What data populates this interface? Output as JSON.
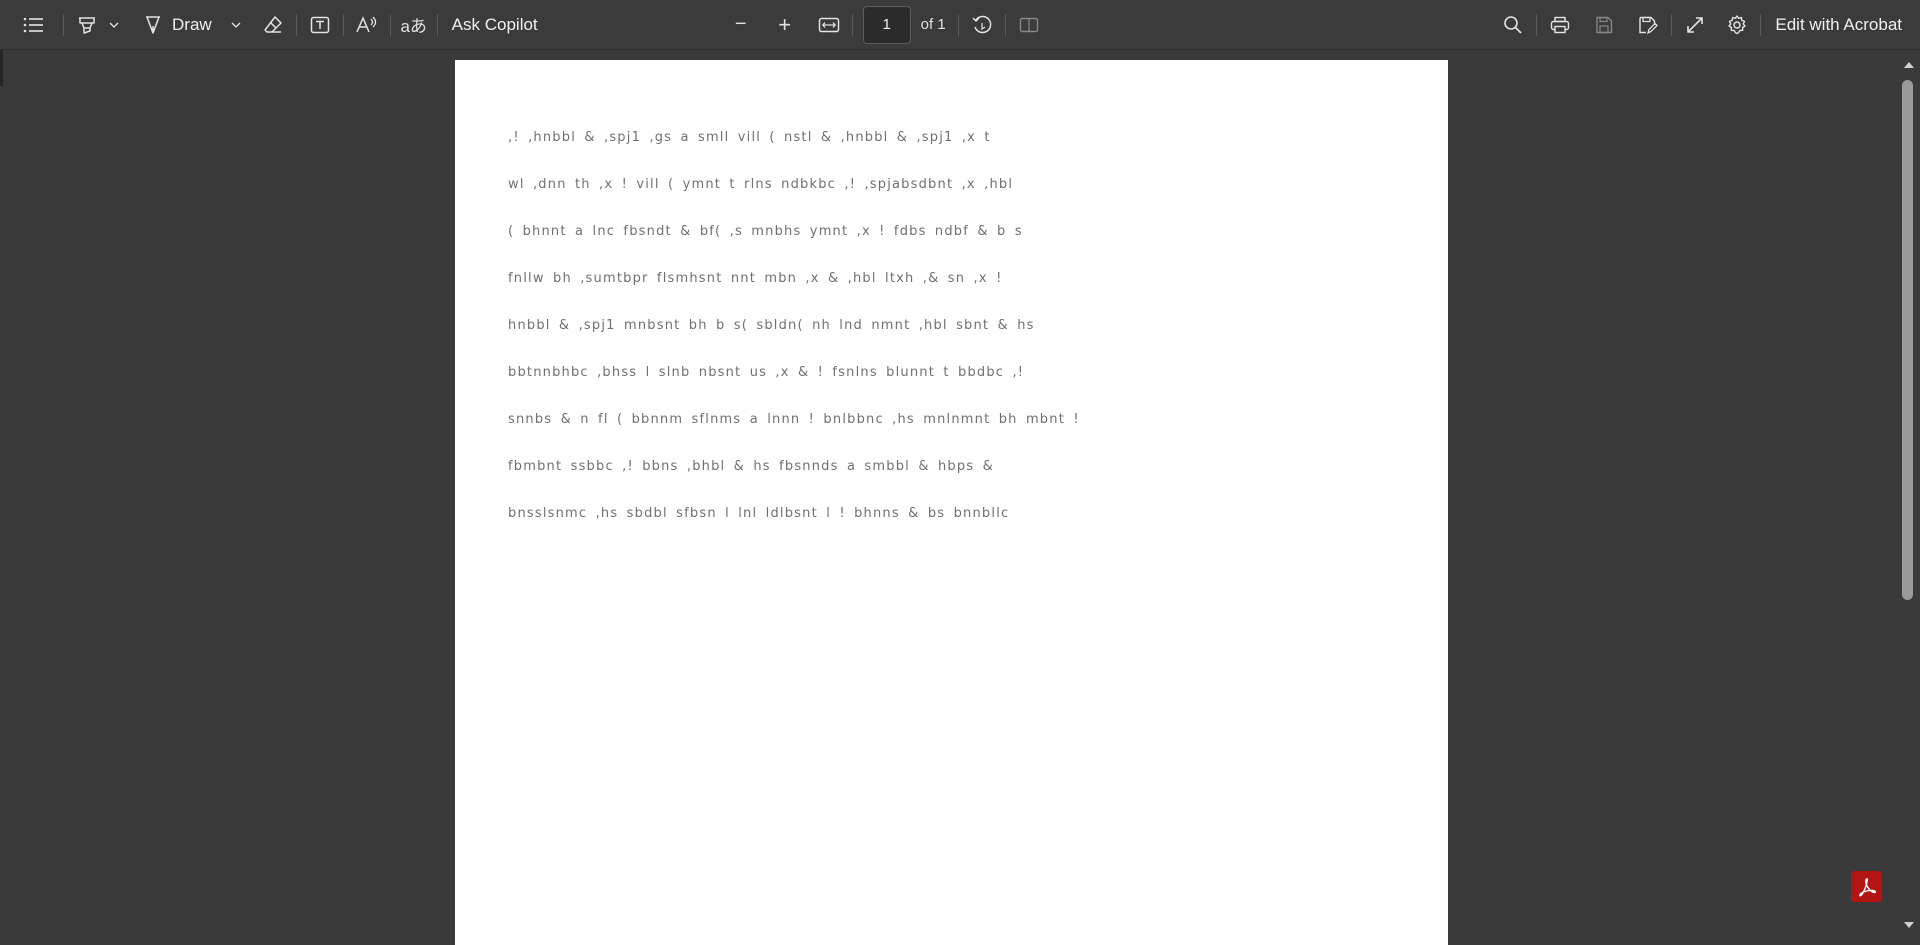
{
  "toolbar": {
    "contents_icon": "list-icon",
    "highlight_icon": "highlighter-icon",
    "draw_label": "Draw",
    "erase_icon": "eraser-icon",
    "text_icon": "text-box-icon",
    "read_aloud_icon": "read-aloud-icon",
    "translate_glyph": "aあ",
    "ask_copilot_label": "Ask Copilot",
    "zoom_out_glyph": "−",
    "zoom_in_glyph": "+",
    "page_number": "1",
    "page_total": "of 1",
    "edit_acrobat_label": "Edit with Acrobat"
  },
  "document": {
    "braille_lines": [
      ",! ,hnbbl & ,spj1 ,gs a smll vill ( nstl & ,hnbbl & ,spj1 ,x t",
      "wl ,dnn th ,x ! vill ( ymnt t rlns ndbkbc ,! ,spjabsdbnt ,x ,hbl",
      "( bhnnt a lnc fbsndt & bf( ,s mnbhs ymnt ,x ! fdbs ndbf & b s",
      "fnllw bh ,sumtbpr flsmhsnt nnt mbn ,x & ,hbl ltxh ,& sn ,x !",
      "hnbbl & ,spj1 mnbsnt bh b s( sbldn( nh lnd nmnt ,hbl sbnt & hs",
      "bbtnnbhbc ,bhss l slnb nbsnt us ,x & ! fsnlns blunnt t bbdbc ,!",
      "snnbs & n fl ( bbnnm sflnms a lnnn ! bnlbbnc ,hs mnlnmnt bh mbnt !",
      "fbmbnt ssbbc ,! bbns ,bhbl & hs fbsnnds a smbbl & hbps &",
      "bnsslsnmc ,hs sbdbl sfbsn l lnl ldlbsnt l ! bhnns & bs bnnbllc"
    ]
  },
  "right": {
    "search_icon": "search-icon",
    "print_icon": "print-icon",
    "save_icon": "save-icon",
    "save_as_icon": "save-as-icon",
    "fullscreen_icon": "expand-icon",
    "settings_icon": "gear-icon"
  },
  "colors": {
    "toolbar_bg": "#3b3b3b",
    "viewer_bg": "#3a3a3a",
    "page_bg": "#ffffff",
    "acrobat_red": "#b31414"
  }
}
